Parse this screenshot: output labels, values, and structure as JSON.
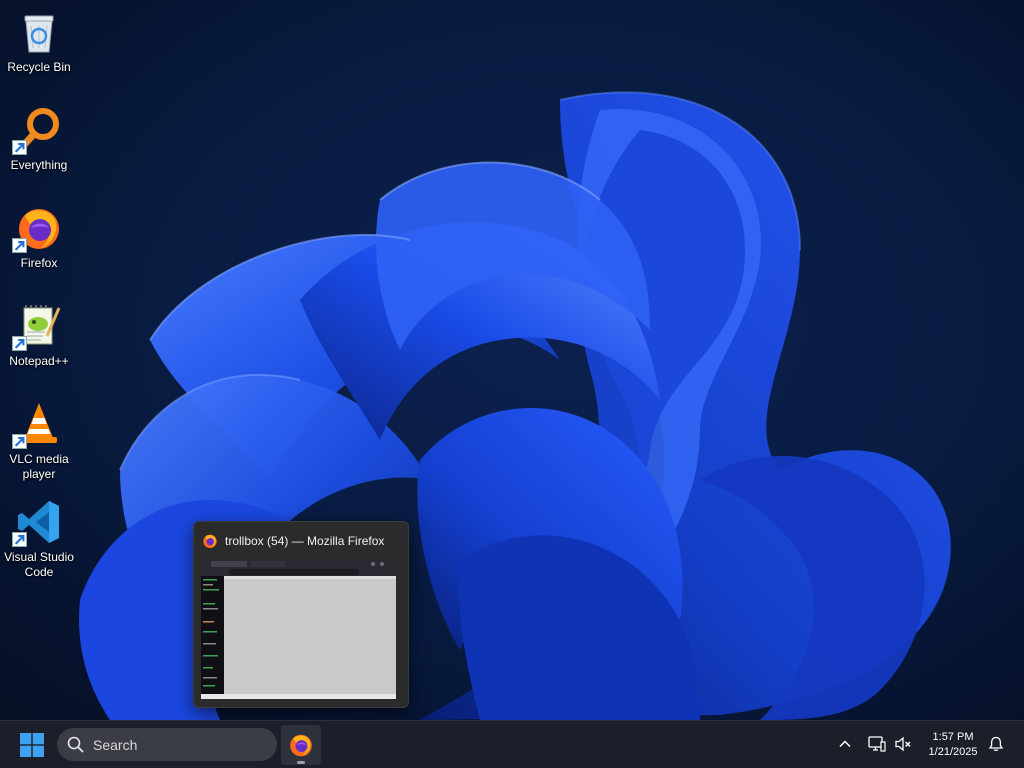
{
  "desktop": {
    "icons": [
      {
        "label": "Recycle Bin",
        "icon": "recycle-bin-icon"
      },
      {
        "label": "Everything",
        "icon": "everything-search-icon"
      },
      {
        "label": "Firefox",
        "icon": "firefox-icon"
      },
      {
        "label": "Notepad++",
        "icon": "notepad-plus-plus-icon"
      },
      {
        "label": "VLC media player",
        "icon": "vlc-icon"
      },
      {
        "label": "Visual Studio Code",
        "icon": "vscode-icon"
      }
    ]
  },
  "thumbnail": {
    "title": "trollbox (54) — Mozilla Firefox",
    "icon": "firefox-icon"
  },
  "taskbar": {
    "search_placeholder": "Search",
    "pinned": [
      {
        "name": "Firefox",
        "icon": "firefox-icon",
        "running": true
      }
    ],
    "tray_icons": [
      "chevron-up-icon",
      "network-icon",
      "volume-muted-icon",
      "notification-bell-icon"
    ],
    "time": "1:57 PM",
    "date": "1/21/2025"
  },
  "colors": {
    "wallpaper_bg": "#07142c",
    "bloom": "#1f4fe0",
    "taskbar_bg": "#1b1f29",
    "accent_blue": "#3ea2f0"
  }
}
